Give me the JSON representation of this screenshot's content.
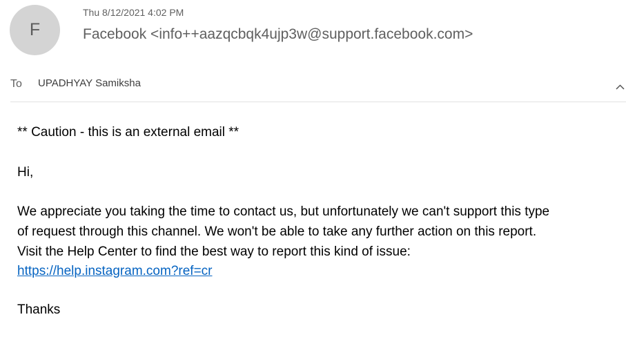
{
  "header": {
    "avatar_initial": "F",
    "datetime": "Thu 8/12/2021 4:02 PM",
    "sender": "Facebook <info++aazqcbqk4ujp3w@support.facebook.com>",
    "to_label": "To",
    "to_name": "UPADHYAY Samiksha",
    "collapse_icon": "chevron-up-icon"
  },
  "message": {
    "caution": "** Caution - this is an external email **",
    "greeting": "Hi,",
    "para_line1": "We appreciate you taking the time to contact us, but unfortunately we can't support this type",
    "para_line2": "of request through this channel. We won't be able to take any further action on this report.",
    "para_line3": "Visit the Help Center to find the best way to report this kind of issue:",
    "link": "https://help.instagram.com?ref=cr",
    "signoff": "Thanks"
  },
  "colors": {
    "link": "#0563c1",
    "avatar_bg": "#d4d4d4"
  }
}
